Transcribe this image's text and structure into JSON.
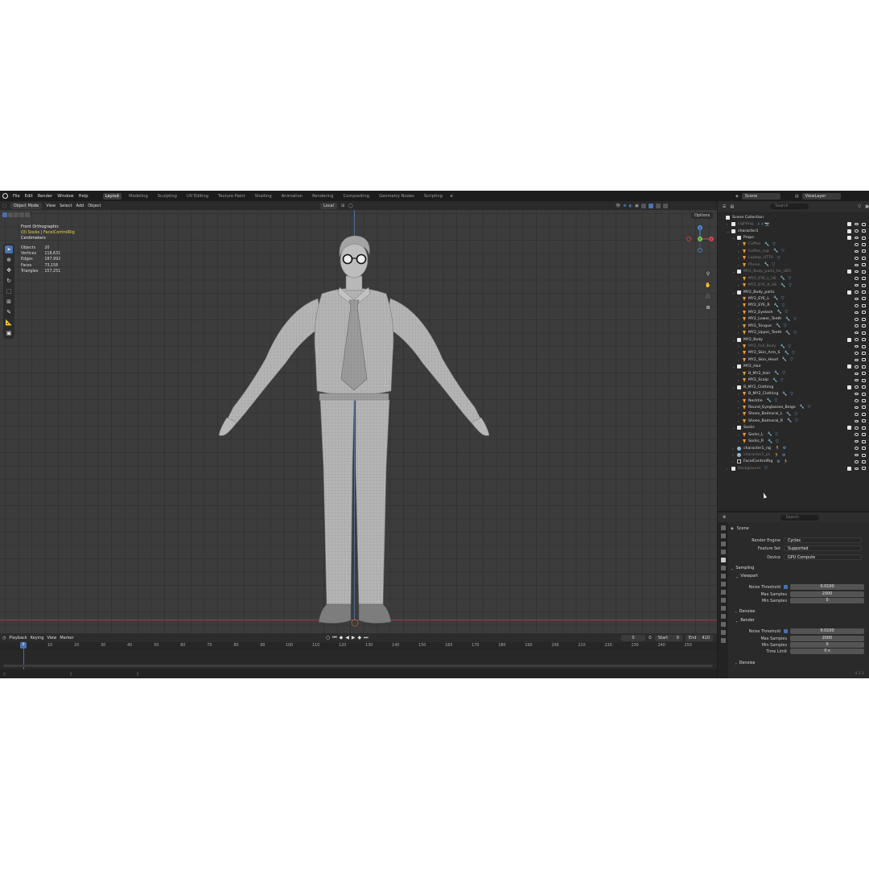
{
  "topbar": {
    "menus": [
      "File",
      "Edit",
      "Render",
      "Window",
      "Help"
    ],
    "workspaces": [
      "Layout",
      "Modeling",
      "Sculpting",
      "UV Editing",
      "Texture Paint",
      "Shading",
      "Animation",
      "Rendering",
      "Compositing",
      "Geometry Nodes",
      "Scripting"
    ],
    "active_workspace": "Layout",
    "scene": "Scene",
    "view_layer": "ViewLayer"
  },
  "viewport": {
    "mode": "Object Mode",
    "menus": [
      "View",
      "Select",
      "Add",
      "Object"
    ],
    "orientation": "Local",
    "options": "Options",
    "view_name": "Front Orthographic",
    "context": "(0) Socks | FacelControlRig",
    "section": "Centimeters",
    "stats": [
      {
        "label": "Objects",
        "value": "20"
      },
      {
        "label": "Vertices",
        "value": "118,631"
      },
      {
        "label": "Edges",
        "value": "187,992"
      },
      {
        "label": "Faces",
        "value": "73,158"
      },
      {
        "label": "Triangles",
        "value": "157,251"
      }
    ],
    "gizmo": {
      "x": "X",
      "y": "Y",
      "z": "Z"
    }
  },
  "timeline": {
    "menus": [
      "Playback",
      "Keying",
      "View",
      "Marker"
    ],
    "current_frame": "0",
    "start_label": "Start",
    "start": "0",
    "end_label": "End",
    "end": "410",
    "ticks": [
      "0",
      "10",
      "20",
      "30",
      "40",
      "50",
      "60",
      "70",
      "80",
      "90",
      "100",
      "110",
      "120",
      "130",
      "140",
      "150",
      "160",
      "170",
      "180",
      "190",
      "200",
      "210",
      "220",
      "230",
      "240",
      "250"
    ]
  },
  "outliner": {
    "search_placeholder": "Search",
    "rows": [
      {
        "indent": 0,
        "type": "coll",
        "label": "Scene Collection",
        "dim": false,
        "mods": "",
        "exp": ""
      },
      {
        "indent": 1,
        "type": "coll",
        "label": "Lighting",
        "dim": true,
        "mods": "⚡⚡📷",
        "exp": "›"
      },
      {
        "indent": 1,
        "type": "coll",
        "label": "character1",
        "dim": false,
        "mods": "",
        "exp": "⌄"
      },
      {
        "indent": 2,
        "type": "coll",
        "label": "Props",
        "dim": false,
        "mods": "",
        "exp": "⌄"
      },
      {
        "indent": 3,
        "type": "obj",
        "label": "Coffee",
        "dim": true,
        "mods": "🔧 ▽",
        "exp": "›"
      },
      {
        "indent": 3,
        "type": "obj",
        "label": "Coffee_cup",
        "dim": true,
        "mods": "🔧 ▽",
        "exp": "›"
      },
      {
        "indent": 3,
        "type": "obj",
        "label": "Laptop_HT70",
        "dim": true,
        "mods": "▽",
        "exp": "›"
      },
      {
        "indent": 3,
        "type": "obj",
        "label": "Phone",
        "dim": true,
        "mods": "🔧 ▽",
        "exp": "›"
      },
      {
        "indent": 2,
        "type": "coll",
        "label": "MY2_Body_parts_for_UE5",
        "dim": true,
        "mods": "",
        "exp": "⌄"
      },
      {
        "indent": 3,
        "type": "obj",
        "label": "MY2_EYE_L_UE",
        "dim": true,
        "mods": "🔧 ▽",
        "exp": "›"
      },
      {
        "indent": 3,
        "type": "obj",
        "label": "MY2_EYE_R_UE",
        "dim": true,
        "mods": "🔧 ▽",
        "exp": "›"
      },
      {
        "indent": 2,
        "type": "coll",
        "label": "MY2_Body_parts",
        "dim": false,
        "mods": "",
        "exp": "⌄"
      },
      {
        "indent": 3,
        "type": "obj",
        "label": "MY2_EYE_L",
        "dim": false,
        "mods": "🔧 ▽",
        "exp": "›"
      },
      {
        "indent": 3,
        "type": "obj",
        "label": "MY2_EYE_R",
        "dim": false,
        "mods": "🔧 ▽",
        "exp": "›"
      },
      {
        "indent": 3,
        "type": "obj",
        "label": "MY2_Eyelash",
        "dim": false,
        "mods": "🔧 ▽",
        "exp": "›"
      },
      {
        "indent": 3,
        "type": "obj",
        "label": "MY2_Lower_Teeth",
        "dim": false,
        "mods": "🔧 ▽",
        "exp": "›"
      },
      {
        "indent": 3,
        "type": "obj",
        "label": "MY2_Tongue",
        "dim": false,
        "mods": "🔧 ▽",
        "exp": "›"
      },
      {
        "indent": 3,
        "type": "obj",
        "label": "MY2_Upper_Teeth",
        "dim": false,
        "mods": "🔧 ▽",
        "exp": "›"
      },
      {
        "indent": 2,
        "type": "coll",
        "label": "MY2_Body",
        "dim": false,
        "mods": "",
        "exp": "⌄"
      },
      {
        "indent": 3,
        "type": "obj",
        "label": "MY2_Full_Body",
        "dim": true,
        "mods": "🔧 ▽",
        "exp": "›"
      },
      {
        "indent": 3,
        "type": "obj",
        "label": "MY2_Skin_Arm_S",
        "dim": false,
        "mods": "🔧 ▽",
        "exp": "›"
      },
      {
        "indent": 3,
        "type": "obj",
        "label": "MY2_Skin_Head",
        "dim": false,
        "mods": "🔧 ▽",
        "exp": "›"
      },
      {
        "indent": 2,
        "type": "coll",
        "label": "MY2_Hair",
        "dim": false,
        "mods": "",
        "exp": "⌄"
      },
      {
        "indent": 3,
        "type": "obj",
        "label": "B_MY2_Hair",
        "dim": false,
        "mods": "🔧 ▽",
        "exp": "›"
      },
      {
        "indent": 3,
        "type": "obj",
        "label": "MY2_Scalp",
        "dim": false,
        "mods": "🔧 ▽",
        "exp": "›"
      },
      {
        "indent": 2,
        "type": "coll",
        "label": "B_MY2_Clothing",
        "dim": false,
        "mods": "",
        "exp": "⌄"
      },
      {
        "indent": 3,
        "type": "obj",
        "label": "B_MY2_Clothing",
        "dim": false,
        "mods": "🔧 ▽",
        "exp": "›"
      },
      {
        "indent": 3,
        "type": "obj",
        "label": "Necktie",
        "dim": false,
        "mods": "🔧 ▽",
        "exp": "›"
      },
      {
        "indent": 3,
        "type": "obj",
        "label": "Round_Eyeglasses_Beige",
        "dim": false,
        "mods": "🔧 ▽",
        "exp": "›"
      },
      {
        "indent": 3,
        "type": "obj",
        "label": "Shoes_Balmoral_L",
        "dim": false,
        "mods": "🔧 ▽",
        "exp": "›"
      },
      {
        "indent": 3,
        "type": "obj",
        "label": "Shoes_Balmoral_R",
        "dim": false,
        "mods": "🔧 ▽",
        "exp": "›"
      },
      {
        "indent": 2,
        "type": "coll",
        "label": "Socks",
        "dim": false,
        "mods": "",
        "exp": "⌄"
      },
      {
        "indent": 3,
        "type": "obj",
        "label": "Socks_L",
        "dim": false,
        "mods": "🔧 ▽",
        "exp": "›"
      },
      {
        "indent": 3,
        "type": "obj",
        "label": "Socks_R",
        "dim": false,
        "mods": "🔧 ▽",
        "exp": "›"
      },
      {
        "indent": 2,
        "type": "arm",
        "label": "character1_rig",
        "dim": false,
        "mods": "🏃 ⚙",
        "exp": "›"
      },
      {
        "indent": 2,
        "type": "arm",
        "label": "character1_ps",
        "dim": true,
        "mods": "🏃 ⚙",
        "exp": "›"
      },
      {
        "indent": 2,
        "type": "empty",
        "label": "FacelControlRig",
        "dim": false,
        "mods": "⚙ 🏃",
        "exp": "›"
      },
      {
        "indent": 1,
        "type": "coll",
        "label": "Background",
        "dim": true,
        "mods": "▽",
        "exp": "›"
      }
    ]
  },
  "properties": {
    "search_placeholder": "Search",
    "breadcrumb": "Scene",
    "render_engine_label": "Render Engine",
    "render_engine": "Cycles",
    "feature_set_label": "Feature Set",
    "feature_set": "Supported",
    "device_label": "Device",
    "device": "GPU Compute",
    "sampling": "Sampling",
    "viewport": "Viewport",
    "vp_noise_label": "Noise Threshold",
    "vp_noise": "0.0100",
    "vp_max_label": "Max Samples",
    "vp_max": "2000",
    "vp_min_label": "Min Samples",
    "vp_min": "0",
    "denoise": "Denoise",
    "render": "Render",
    "r_noise_label": "Noise Threshold",
    "r_noise": "0.0100",
    "r_max_label": "Max Samples",
    "r_max": "2000",
    "r_min_label": "Min Samples",
    "r_min": "0",
    "time_limit_label": "Time Limit",
    "time_limit": "0 s",
    "denoise2": "Denoise",
    "version": "4.1.1"
  },
  "colors": {
    "accent": "#4772b3",
    "x_axis": "#e0424f",
    "y_axis": "#73c74b",
    "z_axis": "#4d87d6",
    "object_orange": "#e99b42"
  }
}
